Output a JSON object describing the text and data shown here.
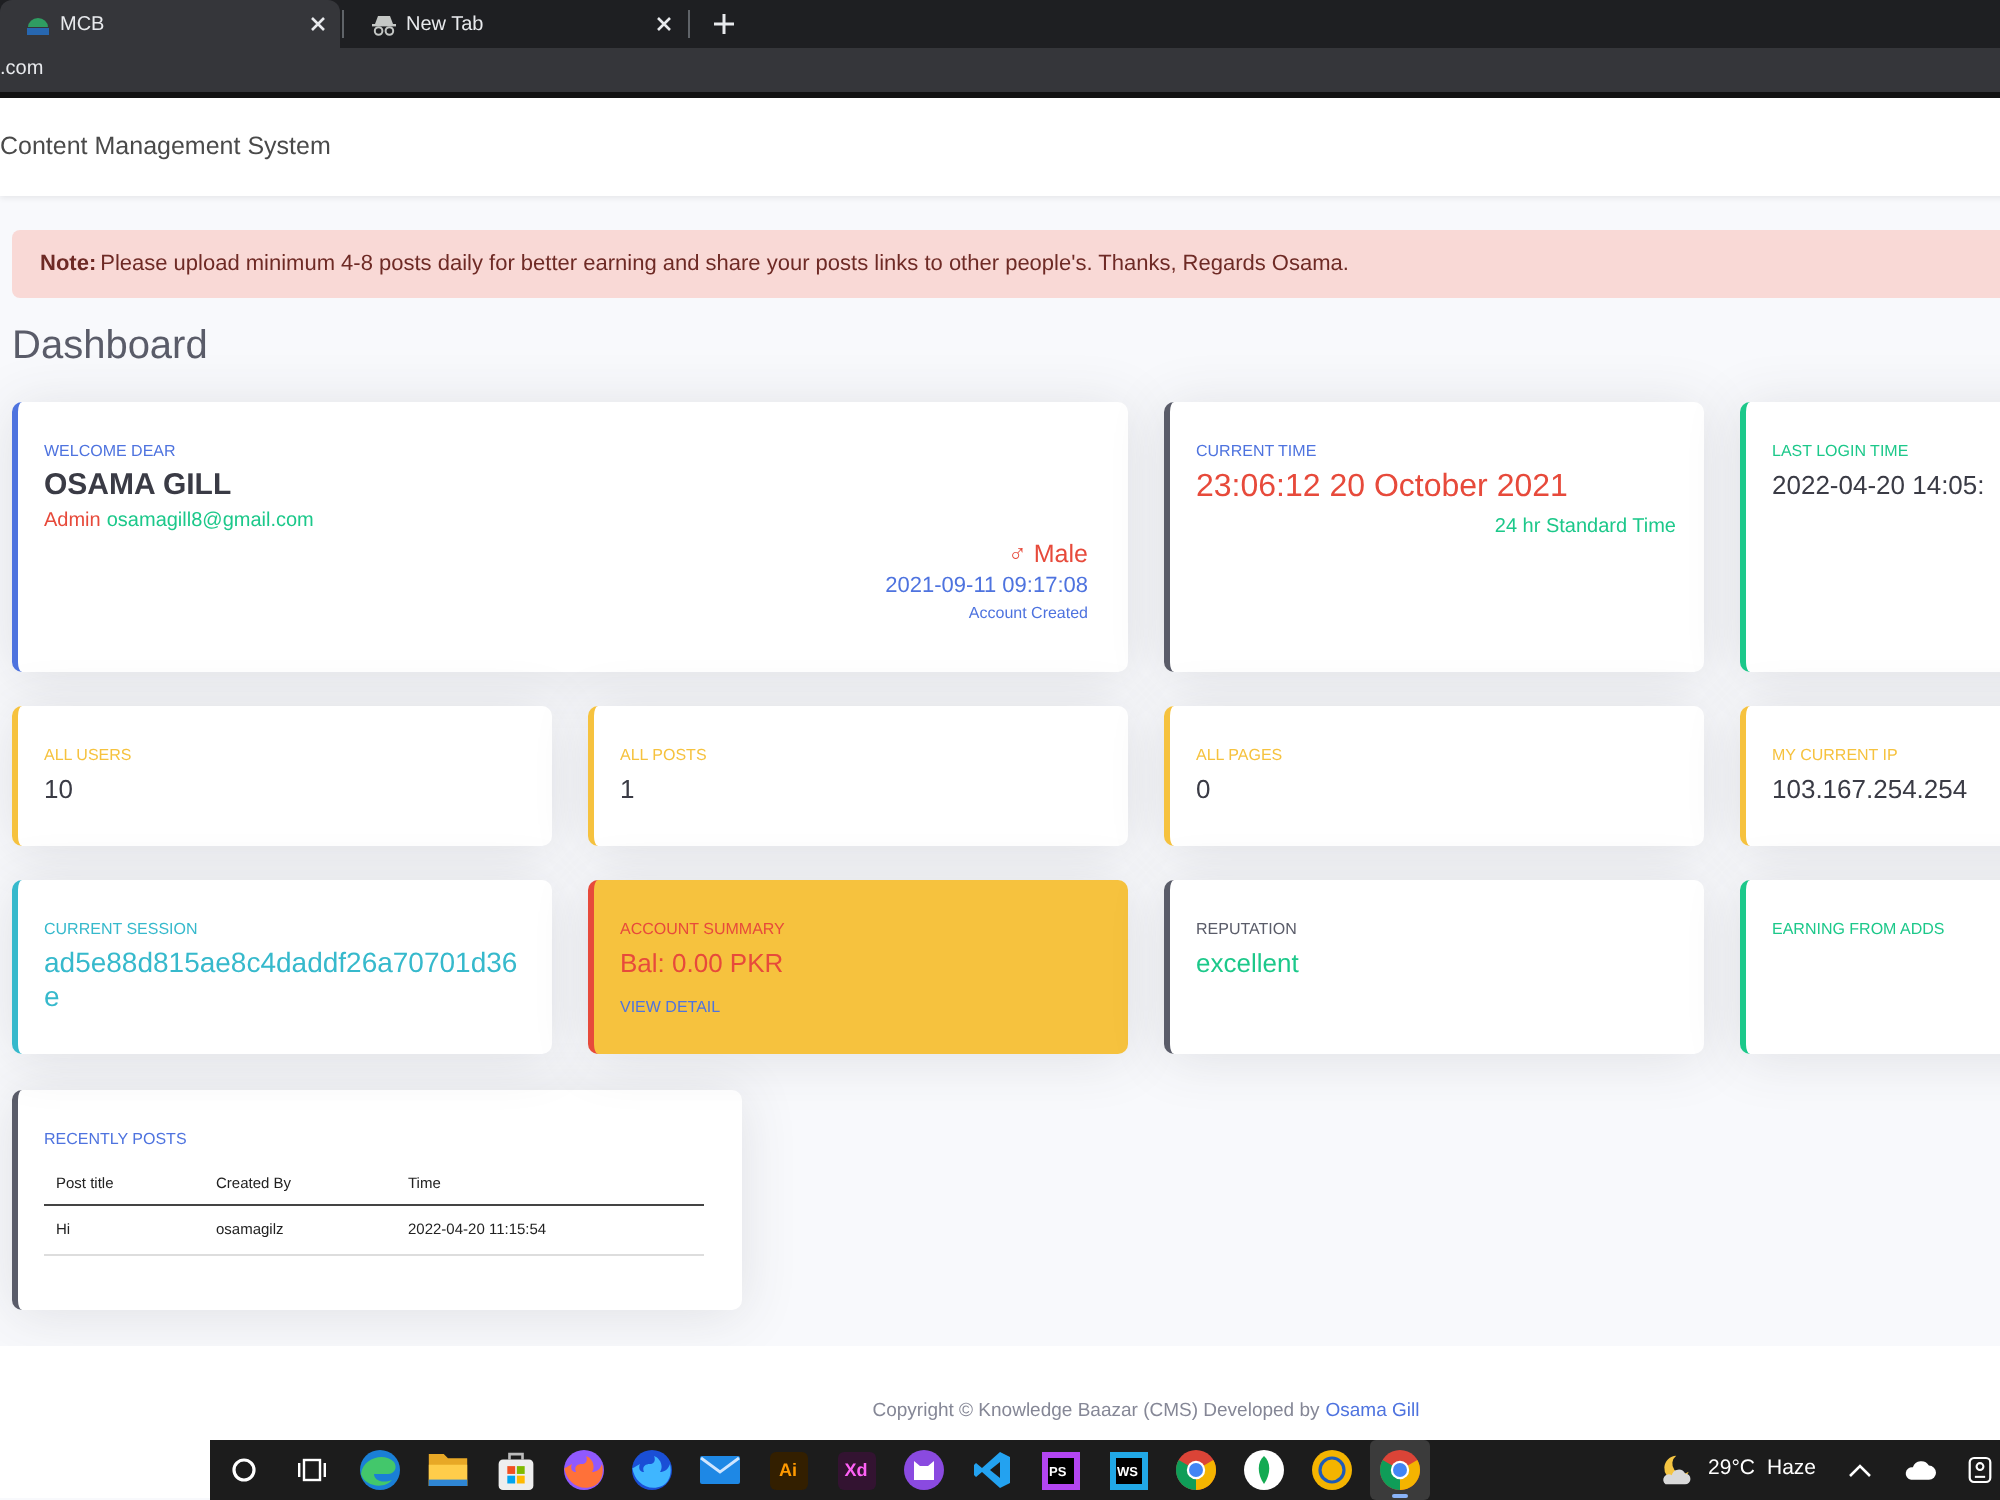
{
  "browser": {
    "tabs": [
      {
        "title": "MCB",
        "kind": "bank",
        "selected": true
      },
      {
        "title": "New Tab",
        "kind": "incognito",
        "selected": false
      }
    ],
    "address": ".com"
  },
  "navbar": {
    "brand": "Content Management System"
  },
  "alert": {
    "text": "**Note:** Please upload minimum 4-8 posts daily for better earning and share your posts links to other people's. Thanks, Regards Osama."
  },
  "heading": "Dashboard",
  "profile": {
    "label": "WELCOME DEAR",
    "name": "OSAMA GILL",
    "role": "Admin",
    "email": "osamagill8@gmail.com",
    "gender": "♂ Male",
    "created": "2021-09-11 09:17:08",
    "created_label": "Account Created"
  },
  "stats": [
    {
      "kind": "time",
      "color": "#5a5c69",
      "label": "CURRENT TIME",
      "value": "23:06:12 20 October 2021",
      "note": "24 hr Standard Time"
    },
    {
      "kind": "stat",
      "color": "#1cc88a",
      "label": "LAST LOGIN TIME",
      "value": "2022-04-20 14:05:"
    },
    {
      "kind": "stat",
      "color": "#f6c23e",
      "label": "ALL USERS",
      "value": "10"
    },
    {
      "kind": "stat",
      "color": "#f6c23e",
      "label": "ALL POSTS",
      "value": "1"
    },
    {
      "kind": "stat",
      "color": "#f6c23e",
      "label": "ALL PAGES",
      "value": "0"
    },
    {
      "kind": "stat",
      "color": "#f6c23e",
      "label": "MY CURRENT IP",
      "value": "103.167.254.254"
    },
    {
      "kind": "session",
      "color": "#36b9cc",
      "label": "CURRENT SESSION",
      "value": "ad5e88d815ae8c4daddf26a70701d36e"
    },
    {
      "kind": "summary",
      "color": "#e74a3b",
      "label": "ACCOUNT SUMMARY",
      "value": "Bal: 0.00 PKR",
      "link": "VIEW DETAIL"
    },
    {
      "kind": "reputation",
      "color": "#5a5c69",
      "label": "REPUTATION",
      "value": "excellent"
    },
    {
      "kind": "stat",
      "color": "#1cc88a",
      "label": "EARNING FROM ADDS"
    }
  ],
  "posts": {
    "title": "RECENTLY POSTS",
    "columns": [
      "Post title",
      "Created By",
      "Time"
    ],
    "rows": [
      [
        "Hi",
        "osamagilz",
        "2022-04-20 11:15:54"
      ]
    ]
  },
  "footer": {
    "text": "Copyright © Knowledge Baazar (CMS) Developed by",
    "link": "Osama Gill"
  },
  "taskbar": {
    "apps": [
      {
        "kind": "search",
        "active": false
      },
      {
        "kind": "taskview",
        "active": false
      },
      {
        "kind": "swirl",
        "active": false
      },
      {
        "kind": "folder",
        "active": false
      },
      {
        "kind": "bag",
        "active": false
      },
      {
        "kind": "fox",
        "active": false
      },
      {
        "kind": "bluefox",
        "active": false
      },
      {
        "kind": "envelope",
        "active": false
      },
      {
        "kind": "tile",
        "label": "Ai",
        "color": "#ff9a00",
        "active": false
      },
      {
        "kind": "tile",
        "label": "Xd",
        "color": "#ff61f6",
        "active": false
      },
      {
        "kind": "cat",
        "active": false
      },
      {
        "kind": "ribbon",
        "active": false
      },
      {
        "kind": "frame",
        "label": "PS",
        "color": "#b345f1",
        "active": false
      },
      {
        "kind": "frame",
        "label": "WS",
        "color": "#21a8e6",
        "active": false
      },
      {
        "kind": "ring",
        "active": false
      },
      {
        "kind": "leaf",
        "active": false
      },
      {
        "kind": "coin",
        "active": false
      },
      {
        "kind": "ring",
        "active": true
      }
    ],
    "weather": {
      "temperature": "29°C",
      "condition": "Haze"
    },
    "tray": [
      {
        "kind": "chevron"
      },
      {
        "kind": "cloud"
      },
      {
        "kind": "webcam"
      }
    ]
  }
}
